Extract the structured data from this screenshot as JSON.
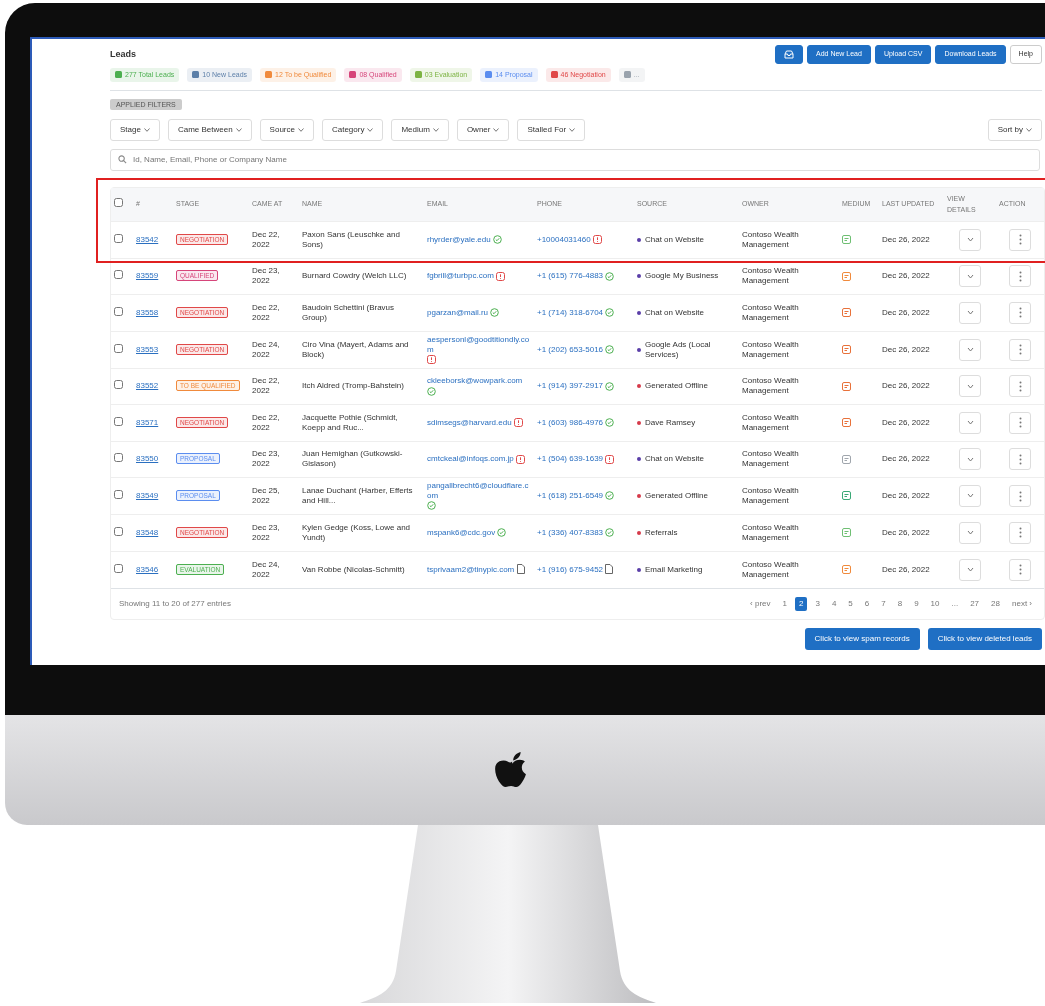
{
  "page_title": "Leads",
  "toolbar": [
    {
      "kind": "icon"
    },
    {
      "kind": "primary",
      "label": "Add New Lead"
    },
    {
      "kind": "primary",
      "label": "Upload CSV"
    },
    {
      "kind": "primary",
      "label": "Download Leads"
    },
    {
      "kind": "plain",
      "label": "Help"
    }
  ],
  "status_pills": [
    {
      "label": "277 Total Leads",
      "color": "#4caf50"
    },
    {
      "label": "10 New Leads",
      "color": "#5c7fa8"
    },
    {
      "label": "12 To be Qualified",
      "color": "#f08a3c"
    },
    {
      "label": "08 Qualified",
      "color": "#d6457a"
    },
    {
      "label": "03 Evaluation",
      "color": "#7cb342"
    },
    {
      "label": "14 Proposal",
      "color": "#5b8def"
    },
    {
      "label": "46 Negotiation",
      "color": "#e04848"
    },
    {
      "label": "...",
      "color": "#9aa3ad"
    }
  ],
  "applied_filter": "APPLIED FILTERS",
  "filters": [
    "Stage",
    "Came Between",
    "Source",
    "Category",
    "Medium",
    "Owner",
    "Stalled For"
  ],
  "sort": "Sort by",
  "search": {
    "placeholder": "Id, Name, Email, Phone or Company Name"
  },
  "table": {
    "all_checked": false,
    "columns": [
      "#",
      "STAGE",
      "CAME AT",
      "NAME",
      "EMAIL",
      "PHONE",
      "SOURCE",
      "OWNER",
      "MEDIUM",
      "LAST UPDATED",
      "VIEW DETAILS",
      "ACTION"
    ],
    "rows": [
      {
        "checked": false,
        "id": "83542",
        "stage": {
          "label": "NEGOTIATION",
          "color": "#e04848"
        },
        "came_at": "Dec 22, 2022",
        "name": "Paxon Sans (Leuschke and Sons)",
        "email": {
          "text": "rhyrder@yale.edu",
          "kind": "verified"
        },
        "phone": {
          "text": "+10004031460",
          "kind": "invalid"
        },
        "source": {
          "label": "Chat on Website",
          "color": "#5a3ea8"
        },
        "owner": "Contoso Wealth Management",
        "medium": {
          "color": "#6fbf73"
        },
        "last_updated": "Dec 26, 2022"
      },
      {
        "checked": false,
        "id": "83559",
        "stage": {
          "label": "QUALIFIED",
          "color": "#d6457a"
        },
        "came_at": "Dec 23, 2022",
        "name": "Burnard Cowdry (Welch LLC)",
        "email": {
          "text": "fgbrill@turbpc.com",
          "kind": "invalid"
        },
        "phone": {
          "text": "+1 (615) 776-4883",
          "kind": "verified"
        },
        "source": {
          "label": "Google My Business",
          "color": "#5a3ea8"
        },
        "owner": "Contoso Wealth Management",
        "medium": {
          "color": "#f08a3c"
        },
        "last_updated": "Dec 26, 2022"
      },
      {
        "checked": false,
        "id": "83558",
        "stage": {
          "label": "NEGOTIATION",
          "color": "#e04848"
        },
        "came_at": "Dec 22, 2022",
        "name": "Baudoin Schettini (Bravus Group)",
        "email": {
          "text": "pgarzan@mail.ru",
          "kind": "verified"
        },
        "phone": {
          "text": "+1 (714) 318-6704",
          "kind": "verified"
        },
        "source": {
          "label": "Chat on Website",
          "color": "#5a3ea8"
        },
        "owner": "Contoso Wealth Management",
        "medium": {
          "color": "#e8713a"
        },
        "last_updated": "Dec 26, 2022"
      },
      {
        "checked": false,
        "id": "83553",
        "stage": {
          "label": "NEGOTIATION",
          "color": "#e04848"
        },
        "came_at": "Dec 24, 2022",
        "name": "Ciro Vina (Mayert, Adams and Block)",
        "email": {
          "text": "aespersonl@goodtitiondly.com",
          "kind": "invalid"
        },
        "phone": {
          "text": "+1 (202) 653-5016",
          "kind": "verified"
        },
        "source": {
          "label": "Google Ads (Local Services)",
          "color": "#5a3ea8"
        },
        "owner": "Contoso Wealth Management",
        "medium": {
          "color": "#e8713a"
        },
        "last_updated": "Dec 26, 2022"
      },
      {
        "checked": false,
        "id": "83552",
        "stage": {
          "label": "TO BE QUALIFIED",
          "color": "#f08a3c"
        },
        "came_at": "Dec 22, 2022",
        "name": "Itch Aldred (Tromp-Bahstein)",
        "email": {
          "text": "ckleeborsk@wowpark.com",
          "kind": "verified"
        },
        "phone": {
          "text": "+1 (914) 397-2917",
          "kind": "verified"
        },
        "source": {
          "label": "Generated Offline",
          "color": "#d63a4a"
        },
        "owner": "Contoso Wealth Management",
        "medium": {
          "color": "#e8713a"
        },
        "last_updated": "Dec 26, 2022"
      },
      {
        "checked": false,
        "id": "83571",
        "stage": {
          "label": "NEGOTIATION",
          "color": "#e04848"
        },
        "came_at": "Dec 22, 2022",
        "name": "Jacquette Pothie (Schmidt, Koepp and Ruc...",
        "email": {
          "text": "sdimsegs@harvard.edu",
          "kind": "invalid"
        },
        "phone": {
          "text": "+1 (603) 986-4976",
          "kind": "verified"
        },
        "source": {
          "label": "Dave Ramsey",
          "color": "#d63a4a"
        },
        "owner": "Contoso Wealth Management",
        "medium": {
          "color": "#e8713a"
        },
        "last_updated": "Dec 26, 2022"
      },
      {
        "checked": false,
        "id": "83550",
        "stage": {
          "label": "PROPOSAL",
          "color": "#5b8def"
        },
        "came_at": "Dec 23, 2022",
        "name": "Juan Hemighan (Gutkowski-Gislason)",
        "email": {
          "text": "cmtckeal@infoqs.com.jp",
          "kind": "invalid"
        },
        "phone": {
          "text": "+1 (504) 639-1639",
          "kind": "invalid"
        },
        "source": {
          "label": "Chat on Website",
          "color": "#5a3ea8"
        },
        "owner": "Contoso Wealth Management",
        "medium": {
          "color": "#a0a6ad"
        },
        "last_updated": "Dec 26, 2022"
      },
      {
        "checked": false,
        "id": "83549",
        "stage": {
          "label": "PROPOSAL",
          "color": "#5b8def"
        },
        "came_at": "Dec 25, 2022",
        "name": "Lanae Duchant (Harber, Efferts and Hill...",
        "email": {
          "text": "pangallbrecht6@cloudflare.com",
          "kind": "verified"
        },
        "phone": {
          "text": "+1 (618) 251-6549",
          "kind": "verified"
        },
        "source": {
          "label": "Generated Offline",
          "color": "#d63a4a"
        },
        "owner": "Contoso Wealth Management",
        "medium": {
          "color": "#3aa876"
        },
        "last_updated": "Dec 26, 2022"
      },
      {
        "checked": false,
        "id": "83548",
        "stage": {
          "label": "NEGOTIATION",
          "color": "#e04848"
        },
        "came_at": "Dec 23, 2022",
        "name": "Kylen Gedge (Koss, Lowe and Yundt)",
        "email": {
          "text": "mspank6@cdc.gov",
          "kind": "verified"
        },
        "phone": {
          "text": "+1 (336) 407-8383",
          "kind": "verified"
        },
        "source": {
          "label": "Referrals",
          "color": "#d63a4a"
        },
        "owner": "Contoso Wealth Management",
        "medium": {
          "color": "#6fbf73"
        },
        "last_updated": "Dec 26, 2022"
      },
      {
        "checked": false,
        "id": "83546",
        "stage": {
          "label": "EVALUATION",
          "color": "#4caf50"
        },
        "came_at": "Dec 24, 2022",
        "name": "Van Robbe (Nicolas-Schmitt)",
        "email": {
          "text": "tsprivaam2@tinypic.com",
          "kind": "unknown"
        },
        "phone": {
          "text": "+1 (916) 675-9452",
          "kind": "unknown"
        },
        "source": {
          "label": "Email Marketing",
          "color": "#5a3ea8"
        },
        "owner": "Contoso Wealth Management",
        "medium": {
          "color": "#f08a3c"
        },
        "last_updated": "Dec 26, 2022"
      }
    ]
  },
  "highlight_first_row": true,
  "entries_info": "Showing 11 to 20 of 277 entries",
  "pagination": [
    {
      "label": "‹ prev",
      "selected": false
    },
    {
      "label": "1",
      "selected": false
    },
    {
      "label": "2",
      "selected": true
    },
    {
      "label": "3",
      "selected": false
    },
    {
      "label": "4",
      "selected": false
    },
    {
      "label": "5",
      "selected": false
    },
    {
      "label": "6",
      "selected": false
    },
    {
      "label": "7",
      "selected": false
    },
    {
      "label": "8",
      "selected": false
    },
    {
      "label": "9",
      "selected": false
    },
    {
      "label": "10",
      "selected": false
    },
    {
      "label": "...",
      "selected": false
    },
    {
      "label": "27",
      "selected": false
    },
    {
      "label": "28",
      "selected": false
    },
    {
      "label": "next ›",
      "selected": false
    }
  ],
  "bottom_buttons": [
    "Click to view spam records",
    "Click to view deleted leads"
  ]
}
